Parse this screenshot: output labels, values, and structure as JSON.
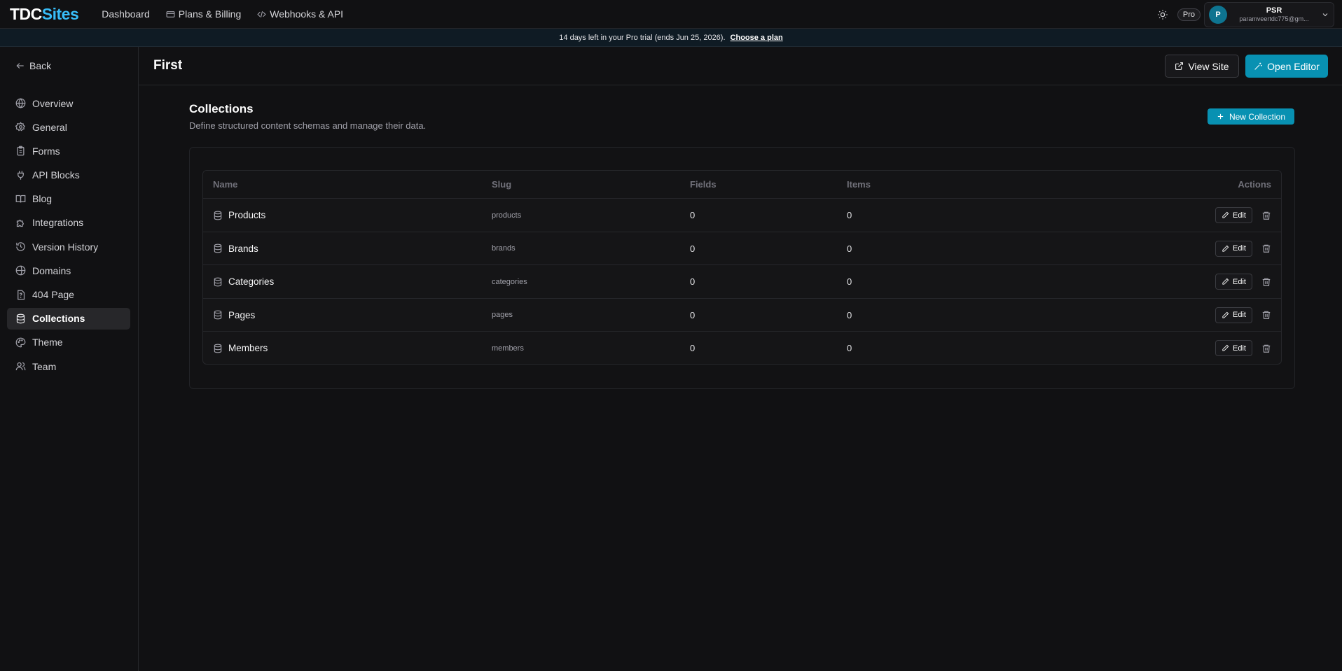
{
  "brand": {
    "part1": "TDC",
    "part2": "Sites"
  },
  "topnav": [
    {
      "label": "Dashboard",
      "icon": ""
    },
    {
      "label": "Plans & Billing",
      "icon": "credit-card-icon"
    },
    {
      "label": "Webhooks & API",
      "icon": "code-icon"
    }
  ],
  "plan_badge": "Pro",
  "user": {
    "initial": "P",
    "name": "PSR",
    "email": "paramveertdc775@gm..."
  },
  "banner": {
    "text": "14 days left in your Pro trial (ends Jun 25, 2026).",
    "link": "Choose a plan"
  },
  "sidebar": {
    "back_label": "Back",
    "items": [
      {
        "label": "Overview",
        "icon": "globe-icon"
      },
      {
        "label": "General",
        "icon": "gear-icon"
      },
      {
        "label": "Forms",
        "icon": "clipboard-icon"
      },
      {
        "label": "API Blocks",
        "icon": "plug-icon"
      },
      {
        "label": "Blog",
        "icon": "book-icon"
      },
      {
        "label": "Integrations",
        "icon": "puzzle-icon"
      },
      {
        "label": "Version History",
        "icon": "history-icon"
      },
      {
        "label": "Domains",
        "icon": "globe-check-icon"
      },
      {
        "label": "404 Page",
        "icon": "file-question-icon"
      },
      {
        "label": "Collections",
        "icon": "database-icon",
        "active": true
      },
      {
        "label": "Theme",
        "icon": "palette-icon"
      },
      {
        "label": "Team",
        "icon": "users-icon"
      }
    ]
  },
  "page": {
    "title": "First",
    "view_site_label": "View Site",
    "open_editor_label": "Open Editor"
  },
  "collections": {
    "title": "Collections",
    "subtitle": "Define structured content schemas and manage their data.",
    "new_button_label": "New Collection",
    "columns": [
      "Name",
      "Slug",
      "Fields",
      "Items",
      "Actions"
    ],
    "edit_label": "Edit",
    "rows": [
      {
        "name": "Products",
        "slug": "products",
        "fields": "0",
        "items": "0"
      },
      {
        "name": "Brands",
        "slug": "brands",
        "fields": "0",
        "items": "0"
      },
      {
        "name": "Categories",
        "slug": "categories",
        "fields": "0",
        "items": "0"
      },
      {
        "name": "Pages",
        "slug": "pages",
        "fields": "0",
        "items": "0"
      },
      {
        "name": "Members",
        "slug": "members",
        "fields": "0",
        "items": "0"
      }
    ]
  },
  "colors": {
    "accent": "#0891b2",
    "brand_accent": "#38bdf8",
    "background": "#111113"
  }
}
